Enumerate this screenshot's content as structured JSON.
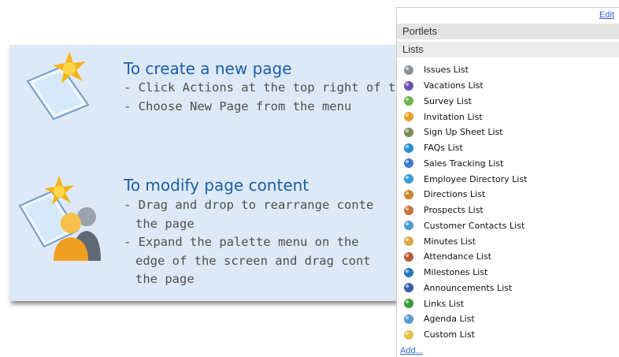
{
  "help": {
    "create": {
      "title": "To create a new page",
      "lines": [
        "- Click Actions at the top right of th",
        "- Choose New Page from the menu"
      ]
    },
    "modify": {
      "title": "To modify page content",
      "lines": [
        "- Drag and drop to rearrange conte",
        "the page",
        "- Expand the palette menu on the",
        "edge of the screen and drag cont",
        "the page"
      ]
    }
  },
  "palette": {
    "edit_label": "Edit",
    "portlets_label": "Portlets",
    "lists_label": "Lists",
    "add_label": "Add...",
    "items": [
      {
        "label": "Issues List",
        "icon": "issues-icon",
        "color": "#8a8fa0"
      },
      {
        "label": "Vacations List",
        "icon": "vacations-icon",
        "color": "#6a4fb3"
      },
      {
        "label": "Survey List",
        "icon": "survey-icon",
        "color": "#6fb24a"
      },
      {
        "label": "Invitation List",
        "icon": "invitation-icon",
        "color": "#e9a12a"
      },
      {
        "label": "Sign Up Sheet List",
        "icon": "sign-up-sheet-icon",
        "color": "#7c8a53"
      },
      {
        "label": "FAQs List",
        "icon": "faqs-icon",
        "color": "#2a8fd2"
      },
      {
        "label": "Sales Tracking List",
        "icon": "sales-tracking-icon",
        "color": "#3c78c8"
      },
      {
        "label": "Employee Directory List",
        "icon": "employee-directory-icon",
        "color": "#3a9ad6"
      },
      {
        "label": "Directions List",
        "icon": "directions-icon",
        "color": "#c8862c"
      },
      {
        "label": "Prospects List",
        "icon": "prospects-icon",
        "color": "#c4743a"
      },
      {
        "label": "Customer Contacts List",
        "icon": "customer-contacts-icon",
        "color": "#4a9ccf"
      },
      {
        "label": "Minutes List",
        "icon": "minutes-icon",
        "color": "#d9a844"
      },
      {
        "label": "Attendance List",
        "icon": "attendance-icon",
        "color": "#b85a3c"
      },
      {
        "label": "Milestones List",
        "icon": "milestones-icon",
        "color": "#2b78c0"
      },
      {
        "label": "Announcements List",
        "icon": "announcements-icon",
        "color": "#3a5ea8"
      },
      {
        "label": "Links List",
        "icon": "links-icon",
        "color": "#3a9a3a"
      },
      {
        "label": "Agenda List",
        "icon": "agenda-icon",
        "color": "#5a9ad0"
      },
      {
        "label": "Custom List",
        "icon": "custom-list-icon",
        "color": "#e2c04a"
      }
    ]
  }
}
